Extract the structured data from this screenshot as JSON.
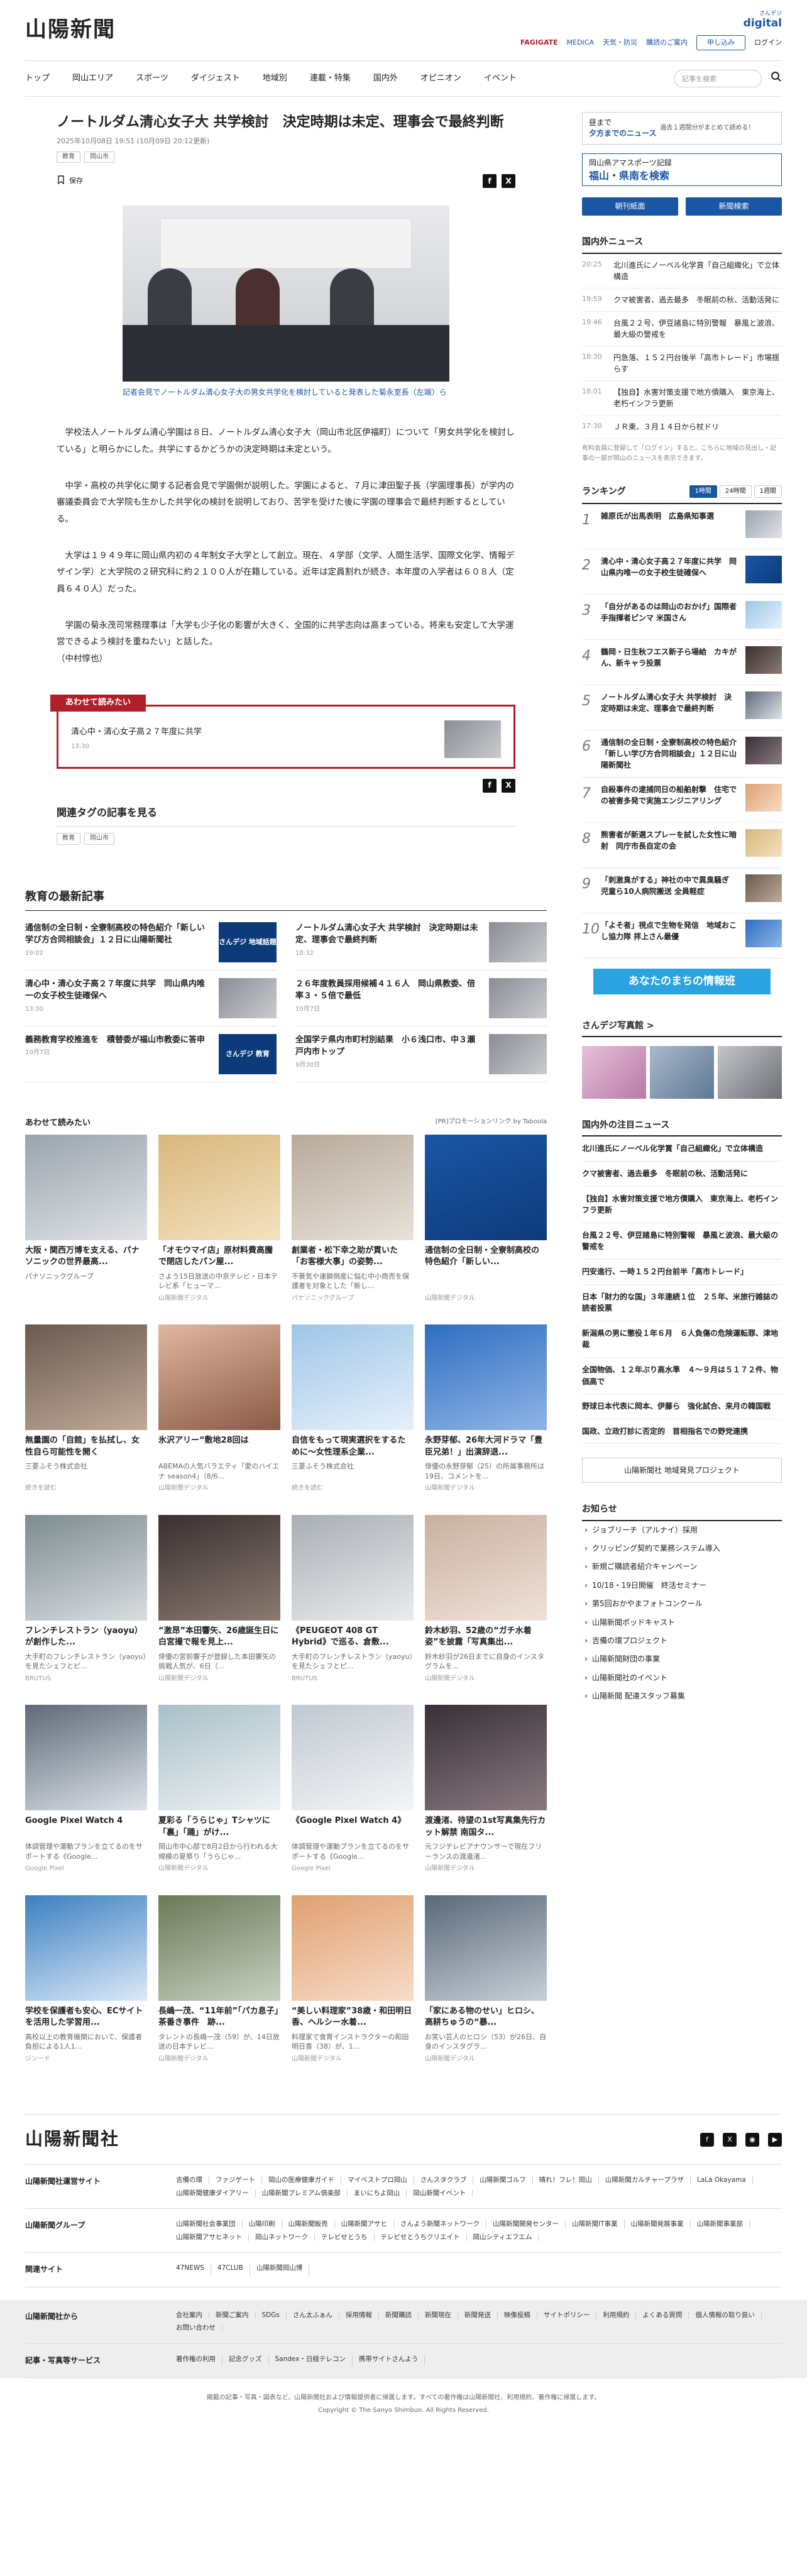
{
  "header": {
    "logo": "山陽新聞",
    "links": [
      "FAGIGATE",
      "MEDICA",
      "天気・防災",
      "購読のご案内"
    ],
    "digital_top": "さんデジ",
    "digital": "digital",
    "subscribe": "申し込み",
    "login": "ログイン"
  },
  "nav": {
    "items": [
      "トップ",
      "岡山エリア",
      "スポーツ",
      "ダイジェスト",
      "地域別",
      "連載・特集",
      "国内外",
      "オピニオン",
      "イベント"
    ],
    "search_placeholder": "記事を検索"
  },
  "article": {
    "title": "ノートルダム清心女子大 共学検討　決定時期は未定、理事会で最終判断",
    "datetime": "2025年10月08日 19:51 (10月09日 20:12更新)",
    "tags": [
      "教育",
      "岡山市"
    ],
    "save": "保存",
    "caption": "記者会見でノートルダム清心女子大の男女共学化を検討していると発表した菊永室長（左端）ら",
    "paragraphs": [
      "学校法人ノートルダム清心学園は８日、ノートルダム清心女子大（岡山市北区伊福町）について「男女共学化を検討している」と明らかにした。共学にするかどうかの決定時期は未定という。",
      "中学・高校の共学化に関する記者会見で学園側が説明した。学園によると、７月に津田聖子長（学園理事長）が学内の審議委員会で大学院も生かした共学化の検討を説明しており、苦学を受けた後に学園の理事会で最終判断するとしている。",
      "大学は１９４９年に岡山県内初の４年制女子大学として創立。現在、４学部（文学、人間生活学、国際文化学、情報デザイン学）と大学院の２研究科に約２１００人が在籍している。近年は定員割れが続き、本年度の入学者は６０８人（定員６４０人）だった。",
      "学園の菊永茂司常務理事は「大学も少子化の影響が大きく、全国的に共学志向は高まっている。将来も安定して大学運営できるよう検討を重ねたい」と話した。\n（中村惇也）"
    ],
    "share_x": "X",
    "share_fb": "f"
  },
  "recommend": {
    "label": "あわせて読みたい",
    "title": "清心中・清心女子高２７年度に共学",
    "date": "13:30"
  },
  "related": {
    "title": "関連タグの記事を見る",
    "tags": [
      "教育",
      "岡山市"
    ]
  },
  "edu": {
    "title": "教育の最新記事",
    "items": [
      {
        "title": "通信制の全日制・全寮制高校の特色紹介「新しい学び方合同相談会」１２日に山陽新聞社",
        "date": "19:02",
        "thumb": "さんデジ 地域話題"
      },
      {
        "title": "ノートルダム清心女子大 共学検討　決定時期は未定、理事会で最終判断",
        "date": "18:32",
        "thumb": ""
      },
      {
        "title": "清心中・清心女子高２７年度に共学　同山県内唯一の女子校生徒確保へ",
        "date": "13:30",
        "thumb": ""
      },
      {
        "title": "２６年度教員採用候補４１６人　岡山県教委、倍率３・５倍で最低",
        "date": "10月7日",
        "thumb": ""
      },
      {
        "title": "義務教育学校推進を　積替委が福山市教委に答申",
        "date": "10月7日",
        "thumb": "さんデジ 教育"
      },
      {
        "title": "全国学テ県内市町村別結果　小６浅口市、中３瀬戸内市トップ",
        "date": "9月30日",
        "thumb": ""
      }
    ]
  },
  "reads": {
    "title": "あわせて読みたい",
    "pr": "[PR]プロモーションリンク by Taboola",
    "cards": [
      {
        "title": "大阪・関西万博を支える、パナソニックの世界最高...",
        "sub": "パナソニックグループ",
        "src": ""
      },
      {
        "title": "「オモウマイ店」原材料費高騰で閉店したパン屋...",
        "sub": "さよう15日放送の中京テレビ・日本テレビ系「ヒューマ...",
        "src": "山陽新聞デジタル"
      },
      {
        "title": "創業者・松下幸之助が貫いた「お客様大事」の姿勢...",
        "sub": "不景気や連鎖倒産に悩む中小商売を保護者を対象とした「新し...",
        "src": "パナソニックグループ"
      },
      {
        "title": "通信制の全日制・全寮制高校の特色紹介「新しい...",
        "sub": "",
        "src": "山陽新聞デジタル"
      },
      {
        "title": "無量園の「自館」を払拭し、女性自ら可能性を開く",
        "sub": "三菱ふそう株式会社",
        "src": "続きを読む"
      },
      {
        "title": "氷沢アリー“敷地28回は",
        "sub": "ABEMAの人気バラエティ「愛のハイエナ season4」（8/6...",
        "src": "山陽新聞デジタル"
      },
      {
        "title": "自信をもって現実選択をするために〜女性理系企業...",
        "sub": "三菱ふそう株式会社",
        "src": "続きを読む"
      },
      {
        "title": "永野芽郁、26年大河ドラマ「豊臣兄弟！」出演辞退...",
        "sub": "俳優の永野芽郁（25）の所属事務所は19日、コメントを...",
        "src": "山陽新聞デジタル"
      },
      {
        "title": "フレンチレストラン（yaoyu）が創作した...",
        "sub": "大手町のフレンチレストラン（yaoyu）を見たシェフとピ...",
        "src": "BRUTUS"
      },
      {
        "title": "“激昂”本田響矢、26歳誕生日に白宮撮で報を見上...",
        "sub": "俳優の宮前響子が登録した本田響矢の挑戦人気が、6日（...",
        "src": "山陽新聞デジタル"
      },
      {
        "title": "《PEUGEOT 408 GT Hybrid》で巡る、倉敷...",
        "sub": "大手町のフレンチレストラン（yaoyu）を見たシェフとピ...",
        "src": "BRUTUS"
      },
      {
        "title": "鈴木紗羽、52歳の“ガチ水着姿”を披露「写真集出...",
        "sub": "鈴木紗羽が26日までに自身のインスタグラムを...",
        "src": "山陽新聞デジタル"
      },
      {
        "title": "Google Pixel Watch 4",
        "sub": "体調管理や運動プランを立てるのをサポートする《Google...",
        "src": "Google Pixel"
      },
      {
        "title": "夏彩る「うらじゃ」Tシャツに「裏」「踊」がけ...",
        "sub": "岡山市中心部で8月2日から行われる大規模の夏祭り「うらじゃ...",
        "src": "山陽新聞デジタル"
      },
      {
        "title": "《Google Pixel Watch 4》",
        "sub": "体調管理や運動プランを立てるのをサポートする《Google...",
        "src": "Google Pixel"
      },
      {
        "title": "渡邊渚、待望の1st写真集先行カット解禁 南国タ...",
        "sub": "元フジテレビアナウンサーで現在フリーランスの渡邊渚...",
        "src": "山陽新聞デジタル"
      },
      {
        "title": "学校を保護者も安心、ECサイトを活用した学習用...",
        "sub": "高校以上の教育機関において、保護者負担による1人1...",
        "src": "ジンード"
      },
      {
        "title": "長嶋一茂、“11年前”「パカ息子」茶番き事件　跡...",
        "sub": "タレントの長嶋一茂（59）が、14日放送の日本テレビ...",
        "src": "山陽新聞デジタル"
      },
      {
        "title": "“美しい料理家”38歳・和田明日香、ヘルシー水着...",
        "sub": "料理家で食育インストラクターの和田明日香（38）が、1...",
        "src": "山陽新聞デジタル"
      },
      {
        "title": "「家にある物のせい」ヒロシ、高耕ちゅうの“暴...",
        "sub": "お笑い芸人のヒロシ（53）が26日、自身のインスタグラ...",
        "src": "山陽新聞デジタル"
      }
    ]
  },
  "sidebar": {
    "ad1_a": "昼まで",
    "ad1_b": "夕方までのニュース",
    "ad1_note": "過去１週間分がまとめて読める！",
    "ad2_a": "岡山県アマスポーツ記録",
    "ad2_b": "福山・県南を検索",
    "btn_paper": "朝刊紙面",
    "btn_fast": "新聞検索",
    "domestic_title": "国内外ニュース",
    "domestic": [
      {
        "time": "20:25",
        "title": "北川進氏にノーベル化学賞「自己組織化」で立体構造"
      },
      {
        "time": "19:59",
        "title": "クマ被害者、過去最多　冬眠前の秋、活動活発に"
      },
      {
        "time": "19:46",
        "title": "台風２２号、伊豆諸島に特別警報　暴風と波浪、最大級の警戒を"
      },
      {
        "time": "18:30",
        "title": "円急落、１５２円台後半「高市トレード」市場揺らす"
      },
      {
        "time": "18:01",
        "title": "【独自】水害対策支援で地方債購入　東京海上、老朽インフラ更新"
      },
      {
        "time": "17:30",
        "title": "ＪＲ東、３月１４日から杖ドリ"
      }
    ],
    "note": "有料会員に登録して「ログイン」すると、こちらに地域の見出し・記事の一部が岡山のニュースを表示できます。",
    "ranking_title": "ランキング",
    "ranking_tabs": [
      "1時間",
      "24時間",
      "1週間"
    ],
    "ranking": [
      "雑原氏が出馬表明　広島県知事選",
      "清心中・清心女子高２７年度に共学　岡山県内唯一の女子校生徒確保へ",
      "「自分があるのは岡山のおかげ」国際者手指揮者ピンマ 米国さん",
      "鶴岡・日生秋フエス新子ら場給　カキがん、新キャラ投票",
      "ノートルダム清心女子大 共学検討　決定時期は未定、理事会で最終判断",
      "通信制の全日制・全寮制高校の特色紹介「新しい学び方合同相談会」１２日に山陽新聞社",
      "自殺事件の逮捕同日の船舶射撃　住宅での被害多発で実施エンジニアリング",
      "熊害者が新選スプレーを試した女性に暗射　同庁市長自定の会",
      "「刺激臭がする」神社の中で異臭騒ぎ　児童ら10人病院搬送 全員軽症",
      "「よそ者」視点で生物を発信　地域おこし協力隊 拝上さん最優"
    ],
    "town": "あなたのまちの情報班",
    "photo_title": "さんデジ写真館 >",
    "attention_title": "国内外の注目ニュース",
    "attention": [
      "北川進氏にノーベル化学賞「自己組織化」で立体構造",
      "クマ被害者、過去最多　冬眠前の秋、活動活発に",
      "【独自】水害対策支援で地方債購入　東京海上、老朽インフラ更新",
      "台風２２号、伊豆諸島に特別警報　暴風と波浪、最大級の警戒を",
      "円安進行、一時１５２円台前半「高市トレード」",
      "日本「財力的な国」３年連続１位　２５年、米旅行雑誌の読者投票",
      "新潟県の男に懲役１年６月　６人負傷の危険運転罪、津地裁",
      "全国物価、１２年ぶり高水準　４〜９月は５１７２件、物価高で",
      "野球日本代表に岡本、伊藤ら　強化試合、来月の韓国戦",
      "国政、立政打診に否定的　首相指名での野党連携"
    ],
    "ad3": "山陽新聞社 地域発見プロジェクト",
    "notice_title": "お知らせ",
    "notices": [
      "ジョブリーチ（アルナイ）採用",
      "クリッピング契約で業務システム導入",
      "新規ご購読者紹介キャンペーン",
      "10/18・19日開催　終活セミナー",
      "第5回おかやまフォトコンクール",
      "山陽新聞ポッドキャスト",
      "吉備の環プロジェクト",
      "山陽新聞財団の事業",
      "山陽新聞社のイベント",
      "山陽新聞 配達スタッフ募集"
    ]
  },
  "footer": {
    "logo": "山陽新聞社",
    "rows": [
      {
        "label": "山陽新聞社運営サイト",
        "links": [
          "吉備の環",
          "ファジゲート",
          "岡山の医療健康ガイド",
          "マイベストプロ岡山",
          "さんスタクラブ",
          "山陽新聞ゴルフ",
          "晴れ！フレ！岡山",
          "山陽新聞カルチャープラザ",
          "LaLa Okayama",
          "山陽新聞健康ダイアリー",
          "山陽新聞プレミアム倶楽部",
          "まいにちよ岡山",
          "岡山新聞イベント"
        ]
      },
      {
        "label": "山陽新聞グループ",
        "links": [
          "山陽新聞社会事業団",
          "山陽印刷",
          "山陽新聞販売",
          "山陽新聞アサヒ",
          "さんよう新聞ネットワーク",
          "山陽新聞開発センター",
          "山陽新聞IT事業",
          "山陽新聞発展事業",
          "山陽新聞事業部",
          "山陽新聞アサヒネット",
          "岡山ネットワーク",
          "テレビせとうち",
          "テレビせとうちクリエイト",
          "岡山シティエフエム"
        ]
      },
      {
        "label": "関連サイト",
        "links": [
          "47NEWS",
          "47CLUB",
          "山陽新聞岡山博"
        ]
      }
    ],
    "gray_rows": [
      {
        "label": "山陽新聞社から",
        "links": [
          "会社案内",
          "新聞ご案内",
          "SDGs",
          "さん太ふぁん",
          "採用情報",
          "新聞購読",
          "新聞現在",
          "新聞発送",
          "映像投稿",
          "サイトポリシー",
          "利用規約",
          "よくある質問",
          "個人情報の取り扱い",
          "お問い合わせ"
        ]
      },
      {
        "label": "記事・写真等サービス",
        "links": [
          "著作権の利用",
          "記念グッズ",
          "Sandex・日経テレコン",
          "携帯サイトさんよう"
        ]
      }
    ],
    "copy1": "掲載の記事・写真・図表など、山陽新聞社および情報提供者に帰属します。すべての著作権は山陽新聞社、利用規約、著作権に帰属します。",
    "copy2": "Copyright © The Sanyo Shimbun. All Rights Reserved."
  }
}
